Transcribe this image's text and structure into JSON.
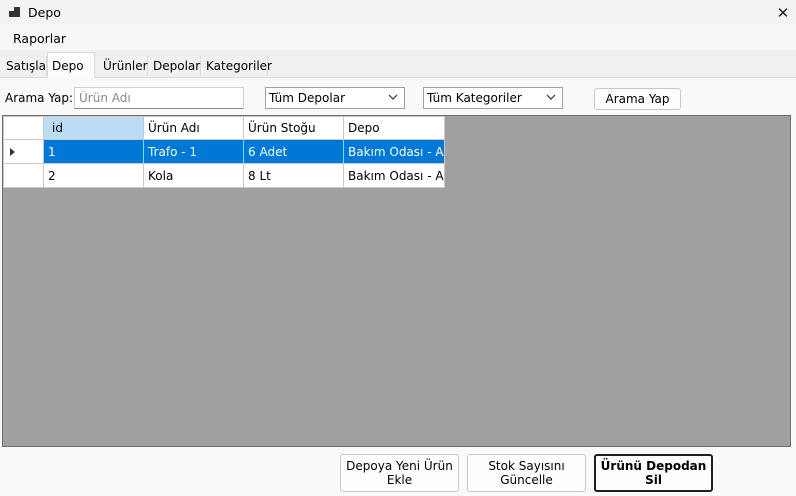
{
  "window": {
    "title": "Depo",
    "close_glyph": "✕",
    "icon": "app-window-icon"
  },
  "menu": {
    "items": [
      "Raporlar"
    ]
  },
  "tabs": [
    {
      "label": "Satışlar",
      "active": false
    },
    {
      "label": "Depo",
      "active": true
    },
    {
      "label": "Ürünler",
      "active": false
    },
    {
      "label": "Depolar",
      "active": false
    },
    {
      "label": "Kategoriler",
      "active": false
    }
  ],
  "search": {
    "label": "Arama Yap:",
    "value": "",
    "placeholder": "Ürün Adı"
  },
  "filters": {
    "warehouse_selected": "Tüm Depolar",
    "category_selected": "Tüm Kategoriler"
  },
  "search_button": "Arama Yap",
  "grid": {
    "columns": [
      "id",
      "Ürün Adı",
      "Ürün Stoğu",
      "Depo"
    ],
    "rows": [
      [
        "1",
        "Trafo - 1",
        "6 Adet",
        "Bakım Odası - A"
      ],
      [
        "2",
        "Kola",
        "8 Lt",
        "Bakım Odası - A"
      ]
    ],
    "selected_row": 0,
    "colors": {
      "selection": "#0078d7",
      "selected_header": "#bcdcf4",
      "empty_area": "#a0a0a0"
    }
  },
  "actions": {
    "add": "Depoya Yeni Ürün Ekle",
    "update_stock": "Stok Sayısını Güncelle",
    "delete": "Ürünü Depodan Sil"
  }
}
